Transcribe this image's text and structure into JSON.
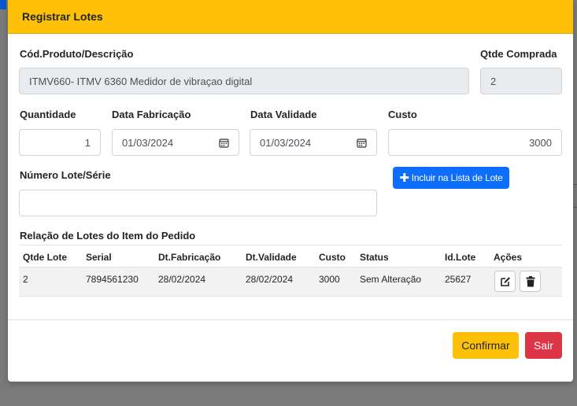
{
  "modal": {
    "title": "Registrar Lotes"
  },
  "form": {
    "product_label": "Cód.Produto/Descrição",
    "product_value": "ITMV660- ITMV 6360 Medidor de vibraçao digital",
    "qty_bought_label": "Qtde Comprada",
    "qty_bought_value": "2",
    "quantity_label": "Quantidade",
    "quantity_value": "1",
    "mfg_date_label": "Data Fabricação",
    "mfg_date_value": "01/03/2024",
    "exp_date_label": "Data Validade",
    "exp_date_value": "01/03/2024",
    "cost_label": "Custo",
    "cost_value": "3000",
    "lot_label": "Número Lote/Série",
    "lot_value": "",
    "include_button": "Incluir na Lista de Lote"
  },
  "lots": {
    "title": "Relação de Lotes do Item do Pedido",
    "headers": [
      "Qtde Lote",
      "Serial",
      "Dt.Fabricação",
      "Dt.Validade",
      "Custo",
      "Status",
      "Id.Lote",
      "Ações"
    ],
    "rows": [
      [
        "2",
        "7894561230",
        "28/02/2024",
        "28/02/2024",
        "3000",
        "Sem Alteração",
        "25627"
      ]
    ]
  },
  "footer": {
    "confirm": "Confirmar",
    "exit": "Sair"
  },
  "icons": {
    "calendar": "calendar-icon",
    "edit": "edit-icon",
    "delete": "trash-icon",
    "plus": "plus-icon"
  },
  "colors": {
    "header": "#ffc107",
    "primary": "#0d6efd",
    "danger": "#dc3545",
    "warning": "#ffc107"
  }
}
